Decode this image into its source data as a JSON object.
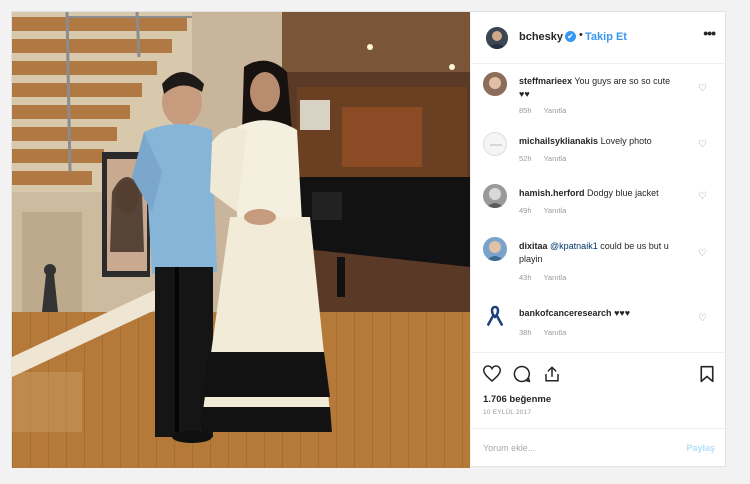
{
  "post": {
    "username": "bcheskу",
    "verified_glyph": "✔",
    "separator": "•",
    "follow_label": "Takip Et",
    "more_glyph": "•••",
    "likes": "1.706 beğenme",
    "date": "10 EYLÜL 2017",
    "comment_placeholder": "Yorum ekle...",
    "post_label": "Paylaş"
  },
  "comments": [
    {
      "user": "steffmarieex",
      "text": "You guys are so so cute ♥♥",
      "time": "85h",
      "reply": "Yanıtla"
    },
    {
      "user": "michailsyklianakis",
      "text": "Lovely photo",
      "time": "52h",
      "reply": "Yanıtla"
    },
    {
      "user": "hamish.herford",
      "text": "Dodgy blue jacket",
      "time": "49h",
      "reply": "Yanıtla"
    },
    {
      "user": "dixitaa",
      "mention": "@kpatnaik1",
      "text": "could be us but u playin",
      "time": "43h",
      "reply": "Yanıtla"
    },
    {
      "user": "bankofcanceresearch",
      "text": "♥♥♥",
      "time": "38h",
      "reply": "Yanıtla"
    }
  ],
  "colors": {
    "accent": "#3897f0",
    "muted": "#999999",
    "post_disabled": "#b2dffc"
  },
  "icons": [
    "verified-badge-icon",
    "more-options-icon",
    "like-heart-icon",
    "comment-bubble-icon",
    "share-icon",
    "bookmark-icon",
    "comment-like-icon",
    "awareness-ribbon-icon"
  ]
}
